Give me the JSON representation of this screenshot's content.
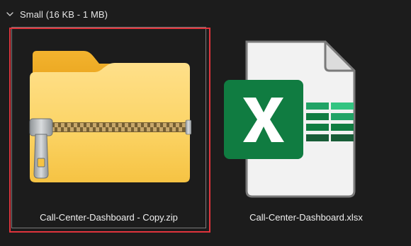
{
  "group": {
    "label": "Small (16 KB - 1 MB)",
    "state": "expanded",
    "icon": "chevron-down-icon"
  },
  "files": [
    {
      "name": "Call-Center-Dashboard - Copy.zip",
      "icon": "zip-folder-icon",
      "selected": true
    },
    {
      "name": "Call-Center-Dashboard.xlsx",
      "icon": "excel-file-icon",
      "selected": false
    }
  ],
  "colors": {
    "background": "#1c1c1c",
    "selection_highlight": "#e0343c",
    "folder_yellow": "#f7c948",
    "excel_green": "#107c41"
  }
}
